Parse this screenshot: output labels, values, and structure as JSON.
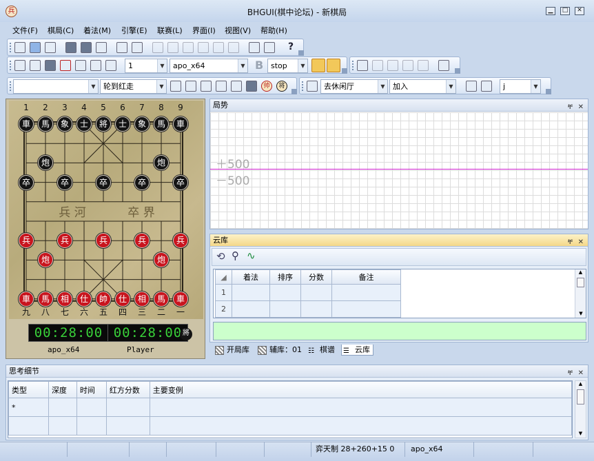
{
  "window": {
    "title": "BHGUI(棋中论坛) - 新棋局",
    "icon_char": "兵"
  },
  "menu": [
    "文件(F)",
    "棋局(C)",
    "着法(M)",
    "引擎(E)",
    "联赛(L)",
    "界面(I)",
    "视图(V)",
    "帮助(H)"
  ],
  "toolbar2": {
    "depth_value": "1",
    "engine_value": "apo_x64",
    "bold_label": "B",
    "stop_value": "stop"
  },
  "toolbar3": {
    "turn_value": "轮到红走",
    "room_value": "去休闲厅",
    "join_value": "加入",
    "j_value": "j",
    "marshal_char": "帅",
    "general_char": "将"
  },
  "board": {
    "file_numbers_top": [
      "1",
      "2",
      "3",
      "4",
      "5",
      "6",
      "7",
      "8",
      "9"
    ],
    "file_numbers_bottom": [
      "九",
      "八",
      "七",
      "六",
      "五",
      "四",
      "三",
      "二",
      "一"
    ],
    "river_left": "兵 河",
    "river_right": "卒 界",
    "pieces": [
      {
        "c": 0,
        "r": 0,
        "ch": "車",
        "side": "black"
      },
      {
        "c": 1,
        "r": 0,
        "ch": "馬",
        "side": "black"
      },
      {
        "c": 2,
        "r": 0,
        "ch": "象",
        "side": "black"
      },
      {
        "c": 3,
        "r": 0,
        "ch": "士",
        "side": "black"
      },
      {
        "c": 4,
        "r": 0,
        "ch": "將",
        "side": "black"
      },
      {
        "c": 5,
        "r": 0,
        "ch": "士",
        "side": "black"
      },
      {
        "c": 6,
        "r": 0,
        "ch": "象",
        "side": "black"
      },
      {
        "c": 7,
        "r": 0,
        "ch": "馬",
        "side": "black"
      },
      {
        "c": 8,
        "r": 0,
        "ch": "車",
        "side": "black"
      },
      {
        "c": 1,
        "r": 2,
        "ch": "炮",
        "side": "black"
      },
      {
        "c": 7,
        "r": 2,
        "ch": "炮",
        "side": "black"
      },
      {
        "c": 0,
        "r": 3,
        "ch": "卒",
        "side": "black"
      },
      {
        "c": 2,
        "r": 3,
        "ch": "卒",
        "side": "black"
      },
      {
        "c": 4,
        "r": 3,
        "ch": "卒",
        "side": "black"
      },
      {
        "c": 6,
        "r": 3,
        "ch": "卒",
        "side": "black"
      },
      {
        "c": 8,
        "r": 3,
        "ch": "卒",
        "side": "black"
      },
      {
        "c": 0,
        "r": 6,
        "ch": "兵",
        "side": "red"
      },
      {
        "c": 2,
        "r": 6,
        "ch": "兵",
        "side": "red"
      },
      {
        "c": 4,
        "r": 6,
        "ch": "兵",
        "side": "red"
      },
      {
        "c": 6,
        "r": 6,
        "ch": "兵",
        "side": "red"
      },
      {
        "c": 8,
        "r": 6,
        "ch": "兵",
        "side": "red"
      },
      {
        "c": 1,
        "r": 7,
        "ch": "炮",
        "side": "red"
      },
      {
        "c": 7,
        "r": 7,
        "ch": "炮",
        "side": "red"
      },
      {
        "c": 0,
        "r": 9,
        "ch": "車",
        "side": "red"
      },
      {
        "c": 1,
        "r": 9,
        "ch": "馬",
        "side": "red"
      },
      {
        "c": 2,
        "r": 9,
        "ch": "相",
        "side": "red"
      },
      {
        "c": 3,
        "r": 9,
        "ch": "仕",
        "side": "red"
      },
      {
        "c": 4,
        "r": 9,
        "ch": "帥",
        "side": "red"
      },
      {
        "c": 5,
        "r": 9,
        "ch": "仕",
        "side": "red"
      },
      {
        "c": 6,
        "r": 9,
        "ch": "相",
        "side": "red"
      },
      {
        "c": 7,
        "r": 9,
        "ch": "馬",
        "side": "red"
      },
      {
        "c": 8,
        "r": 9,
        "ch": "車",
        "side": "red"
      }
    ]
  },
  "clocks": {
    "red_badge": "帥",
    "red_time": "00:28:00",
    "red_name": "apo_x64",
    "black_badge": "將",
    "black_time": "00:28:00",
    "black_name": "Player"
  },
  "trend_panel": {
    "title": "局势",
    "label_pos": "＋500",
    "label_neg": "－500"
  },
  "cloud_panel": {
    "title": "云库",
    "columns": [
      "着法",
      "排序",
      "分数",
      "备注"
    ],
    "row_numbers": [
      "1",
      "2"
    ]
  },
  "bottom_tabs": [
    "开局库",
    "辅库：01",
    "棋谱",
    "云库"
  ],
  "think_panel": {
    "title": "思考细节",
    "columns": [
      "类型",
      "深度",
      "时间",
      "红方分数",
      "主要变例"
    ],
    "row_marker": "*"
  },
  "status_bar": {
    "time_control": "弈天制 28+260+15 0",
    "engine": "apo_x64"
  },
  "colors": {
    "trend_line": "#d020d0",
    "red_piece": "#c8141e",
    "black_piece": "#141414",
    "cloud_input_bg": "#ccffcc"
  }
}
